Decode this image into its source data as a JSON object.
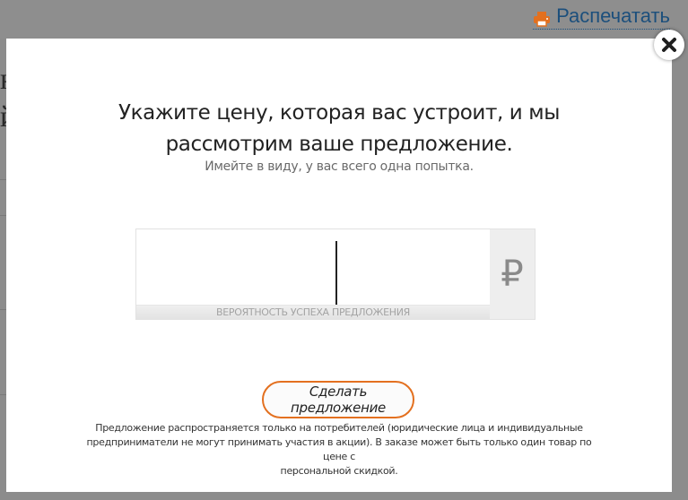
{
  "background": {
    "print_label": "Распечатать",
    "print_icon": "printer-icon",
    "link_color": "#1c4f7c",
    "accent_color": "#e3701f"
  },
  "modal": {
    "close_icon": "close-icon",
    "title_line1": "Укажите цену, которая вас устроит, и мы",
    "title_line2": "рассмотрим ваше предложение.",
    "subtitle": "Имейте в виду, у вас всего одна попытка.",
    "price_input": {
      "value": "",
      "placeholder": ""
    },
    "currency_symbol": "₽",
    "probability_label": "ВЕРОЯТНОСТЬ УСПЕХА ПРЕДЛОЖЕНИЯ",
    "offer_button_label": "Сделать предложение",
    "offer_button_border_color": "#e3701f",
    "disclaimer_line1": "Предложение распространяется только на потребителей (юридические лица и индивидуальные",
    "disclaimer_line2": "предприниматели не могут принимать участия в акции). В заказе может быть только один товар по цене с",
    "disclaimer_line3": "персональной скидкой."
  }
}
